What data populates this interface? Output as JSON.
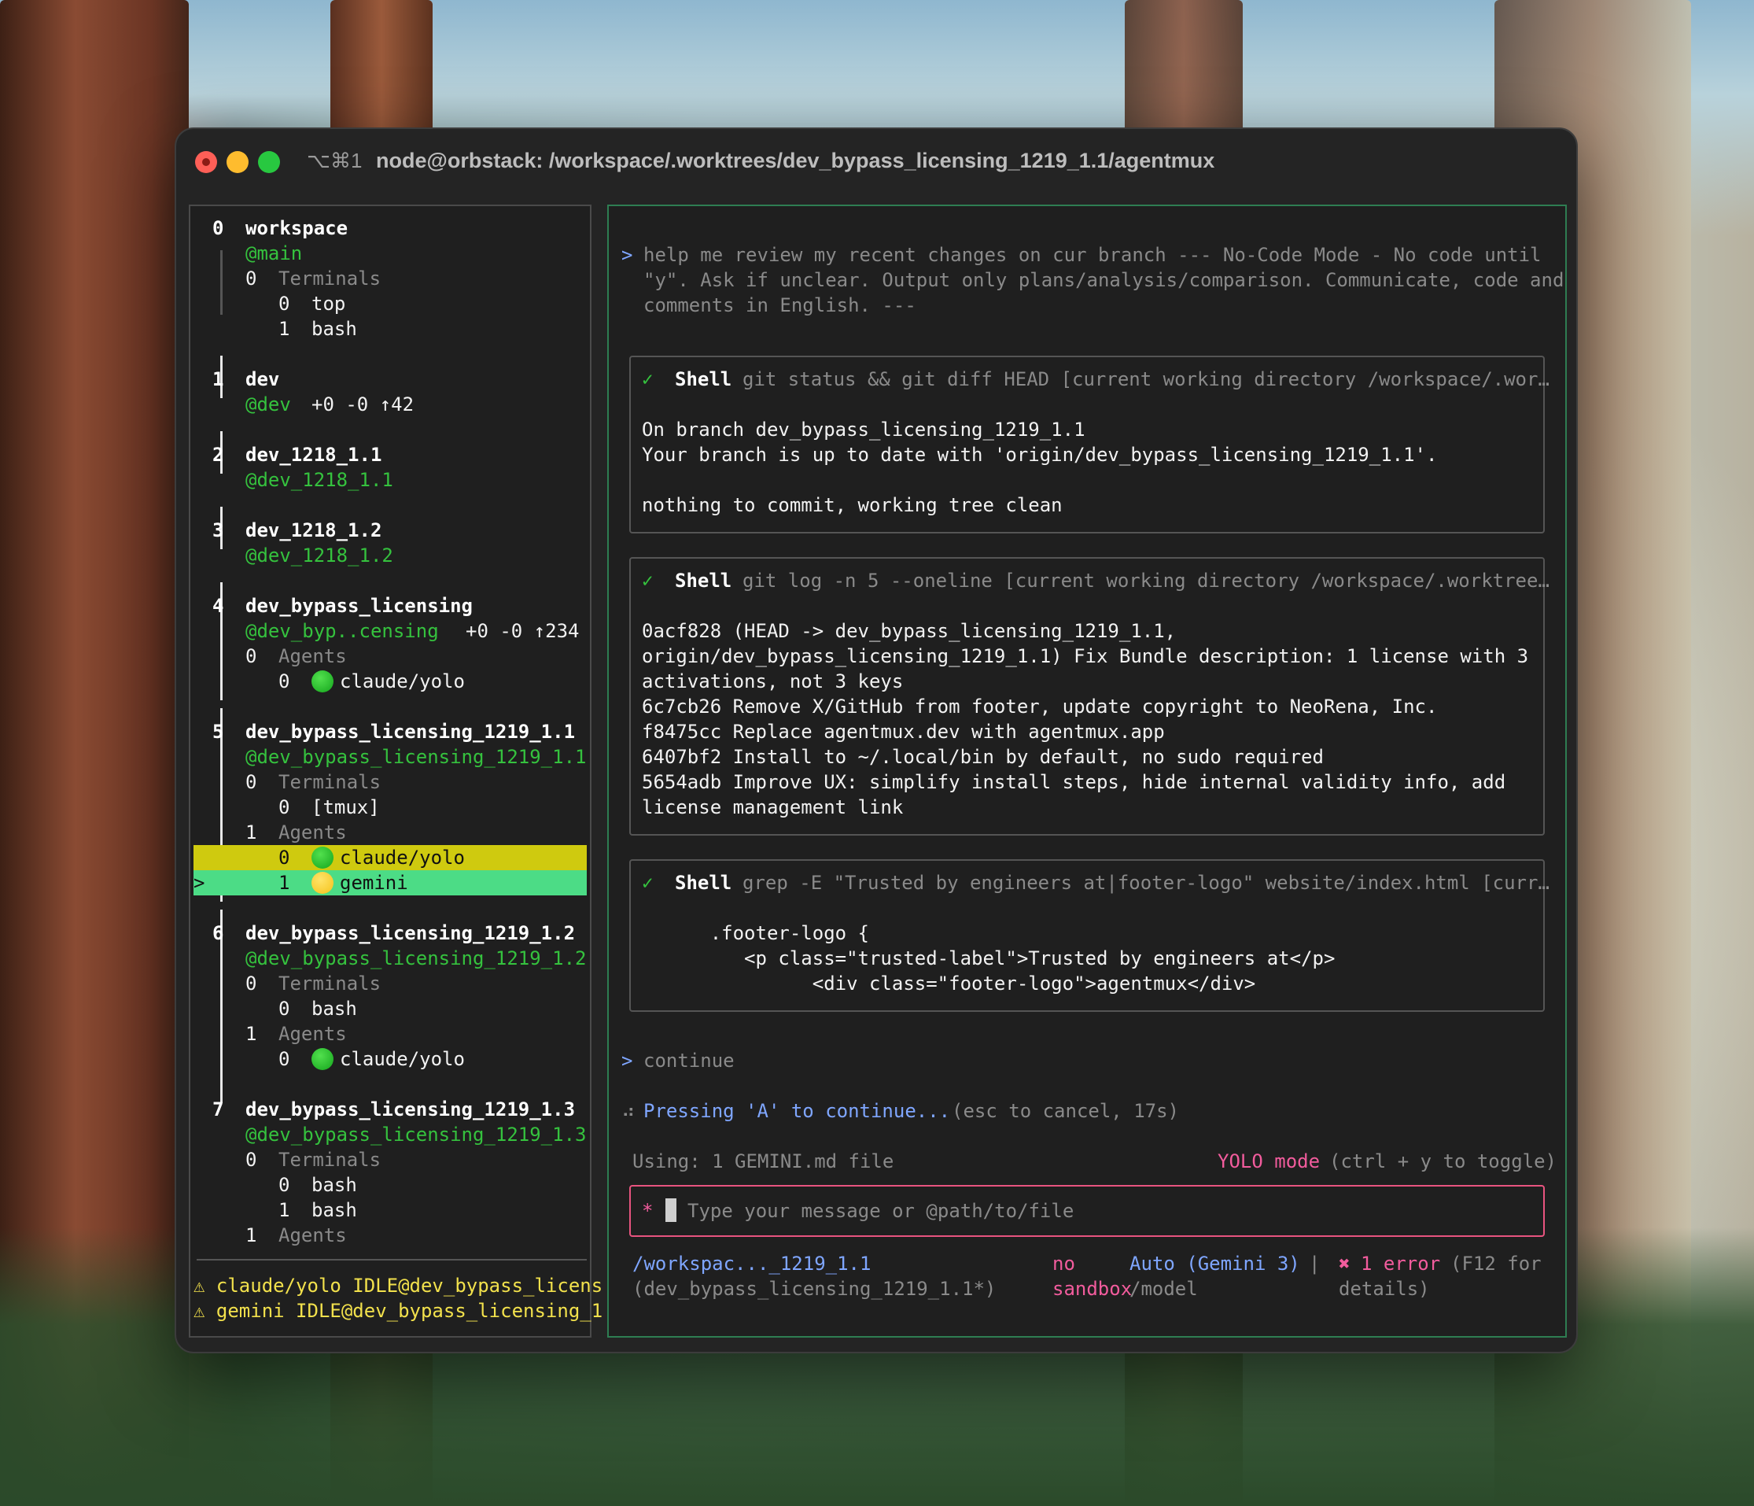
{
  "window": {
    "shortcut": "⌥⌘1",
    "title": "node@orbstack: /workspace/.worktrees/dev_bypass_licensing_1219_1.1/agentmux"
  },
  "sidebar": {
    "sessions": [
      {
        "index": "0",
        "name": "workspace",
        "branch": "@main",
        "groups": [
          {
            "index": "0",
            "label": "Terminals",
            "items": [
              {
                "index": "0",
                "name": "top"
              },
              {
                "index": "1",
                "name": "bash"
              }
            ]
          }
        ]
      },
      {
        "index": "1",
        "name": "dev",
        "branch": "@dev",
        "stats": "+0 -0 ↑42"
      },
      {
        "index": "2",
        "name": "dev_1218_1.1",
        "branch": "@dev_1218_1.1"
      },
      {
        "index": "3",
        "name": "dev_1218_1.2",
        "branch": "@dev_1218_1.2"
      },
      {
        "index": "4",
        "name": "dev_bypass_licensing",
        "branch": "@dev_byp..censing",
        "stats": "+0 -0 ↑234",
        "groups": [
          {
            "index": "0",
            "label": "Agents",
            "items": [
              {
                "index": "0",
                "name": "claude/yolo",
                "status": "green"
              }
            ]
          }
        ]
      },
      {
        "index": "5",
        "name": "dev_bypass_licensing_1219_1.1",
        "branch": "@dev_bypass_licensing_1219_1.1",
        "groups": [
          {
            "index": "0",
            "label": "Terminals",
            "items": [
              {
                "index": "0",
                "name": "[tmux]"
              }
            ]
          },
          {
            "index": "1",
            "label": "Agents",
            "items": [
              {
                "index": "0",
                "name": "claude/yolo",
                "status": "green"
              },
              {
                "index": "1",
                "name": "gemini",
                "status": "yellow",
                "cursor": ">"
              }
            ]
          }
        ]
      },
      {
        "index": "6",
        "name": "dev_bypass_licensing_1219_1.2",
        "branch": "@dev_bypass_licensing_1219_1.2",
        "groups": [
          {
            "index": "0",
            "label": "Terminals",
            "items": [
              {
                "index": "0",
                "name": "bash"
              }
            ]
          },
          {
            "index": "1",
            "label": "Agents",
            "items": [
              {
                "index": "0",
                "name": "claude/yolo",
                "status": "green"
              }
            ]
          }
        ]
      },
      {
        "index": "7",
        "name": "dev_bypass_licensing_1219_1.3",
        "branch": "@dev_bypass_licensing_1219_1.3",
        "groups": [
          {
            "index": "0",
            "label": "Terminals",
            "items": [
              {
                "index": "0",
                "name": "bash"
              },
              {
                "index": "1",
                "name": "bash"
              }
            ]
          },
          {
            "index": "1",
            "label": "Agents"
          }
        ]
      }
    ],
    "warnings": [
      "⚠ claude/yolo IDLE@dev_bypass_licens",
      "⚠ gemini IDLE@dev_bypass_licensing_1"
    ]
  },
  "main": {
    "prompt_lines": [
      "help me review my recent changes on cur branch --- No-Code Mode - No code until",
      "\"y\". Ask if unclear. Output only plans/analysis/comparison. Communicate, code and",
      "comments in English. ---"
    ],
    "prompt_marker": ">",
    "tool_calls": [
      {
        "check": "✓",
        "name": "Shell",
        "command": "git status && git diff HEAD [current working directory /workspace/.wor…",
        "output": [
          "On branch dev_bypass_licensing_1219_1.1",
          "Your branch is up to date with 'origin/dev_bypass_licensing_1219_1.1'.",
          "",
          "nothing to commit, working tree clean"
        ]
      },
      {
        "check": "✓",
        "name": "Shell",
        "command": "git log -n 5 --oneline [current working directory /workspace/.worktree…",
        "output": [
          "0acf828 (HEAD -> dev_bypass_licensing_1219_1.1,",
          "origin/dev_bypass_licensing_1219_1.1) Fix Bundle description: 1 license with 3",
          "activations, not 3 keys",
          "6c7cb26 Remove X/GitHub from footer, update copyright to NeoRena, Inc.",
          "f8475cc Replace agentmux.dev with agentmux.app",
          "6407bf2 Install to ~/.local/bin by default, no sudo required",
          "5654adb Improve UX: simplify install steps, hide internal validity info, add",
          "license management link"
        ]
      },
      {
        "check": "✓",
        "name": "Shell",
        "command": "grep -E \"Trusted by engineers at|footer-logo\" website/index.html [curr…",
        "output": [
          "      .footer-logo {",
          "         <p class=\"trusted-label\">Trusted by engineers at</p>",
          "               <div class=\"footer-logo\">agentmux</div>"
        ]
      }
    ],
    "continue_text": "continue",
    "spinner": "⠴",
    "status_action": "Pressing 'A' to continue...",
    "status_hint": "(esc to cancel, 17s)",
    "using": "Using: 1 GEMINI.md file",
    "yolo_label": "YOLO mode",
    "yolo_hint": "(ctrl + y to toggle)",
    "input": {
      "asterisk": "*",
      "placeholder": "Type your message or @path/to/file"
    },
    "footer": {
      "path": "/workspac..._1219_1.1",
      "branch": "(dev_bypass_licensing_1219_1.1*)",
      "sandbox_1": "no",
      "sandbox_2": "sandbox",
      "model_1": "Auto (Gemini 3)",
      "model_2": "/model",
      "divider": "|",
      "error_icon": "✖",
      "error_text": "1 error",
      "error_hint_1": "(F12 for",
      "error_hint_2": "details)"
    }
  },
  "colors": {
    "accent_green": "#35c23e",
    "highlight_yellow": "#cfca0f",
    "highlight_green": "#4cdc86",
    "error_pink": "#f25c9d",
    "input_border": "#e8547f",
    "pane_border_active": "#2e7d52"
  }
}
